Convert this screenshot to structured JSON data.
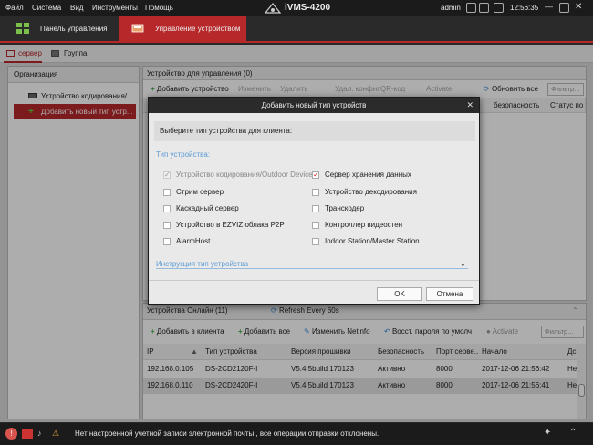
{
  "titlebar": {
    "menu": [
      "Файл",
      "Система",
      "Вид",
      "Инструменты",
      "Помощь"
    ],
    "app_title": "iVMS-4200",
    "user": "admin",
    "clock": "12:56:35"
  },
  "tabs": [
    {
      "label": "Панель управления",
      "icon": "grid-icon"
    },
    {
      "label": "Управление устройством",
      "icon": "device-icon"
    }
  ],
  "subtabs": [
    "сервер",
    "Группа"
  ],
  "organization": {
    "header": "Организация",
    "items": [
      {
        "label": "Устройство кодирования/...",
        "icon": "encoder-icon"
      },
      {
        "label": "Добавить новый тип устр...",
        "icon": "plus-icon"
      }
    ]
  },
  "managed": {
    "header": "Устройство для управления (0)",
    "toolbar": [
      "Добавить устройство",
      "Изменить",
      "Удалить",
      "Удал. конфиг.",
      "QR-код",
      "Activate"
    ],
    "refresh_all": "Обновить все",
    "filter_placeholder": "Фильтр...",
    "columns": [
      "безопасность",
      "Статус по"
    ]
  },
  "online": {
    "tab_label": "Устройства Онлайн (11)",
    "refresh_label": "Refresh Every 60s",
    "toolbar": [
      "Добавить в клиента",
      "Добавить все",
      "Изменить Netinfo",
      "Восст. пароля по умолч",
      "Activate"
    ],
    "filter_placeholder": "Фильтр...",
    "columns": [
      "IP",
      "Тип устройства",
      "Версия прошивки",
      "Безопасность",
      "Порт серве...",
      "Начало",
      "Дс"
    ],
    "rows": [
      [
        "192.168.0.105",
        "DS-2CD2120F-I",
        "V5.4.5build 170123",
        "Активно",
        "8000",
        "2017-12-06 21:56:42",
        "Не"
      ],
      [
        "192.168.0.110",
        "DS-2CD2420F-I",
        "V5.4.5build 170123",
        "Активно",
        "8000",
        "2017-12-06 21:56:41",
        "Не"
      ]
    ]
  },
  "status": {
    "message": "Нет настроенной учетной записи электронной почты , все операции отправки отклонены."
  },
  "dialog": {
    "title": "Добавить новый тип устройств",
    "prompt": "Выберите тип устройства для клиента:",
    "section_label": "Тип устройства:",
    "options_left": [
      {
        "label": "Устройство кодирования/Outdoor Device",
        "checked": true,
        "disabled": true
      },
      {
        "label": "Стрим сервер",
        "checked": false,
        "disabled": false
      },
      {
        "label": "Каскадный сервер",
        "checked": false,
        "disabled": false
      },
      {
        "label": "Устройство в EZVIZ облака P2P",
        "checked": false,
        "disabled": false
      },
      {
        "label": "AlarmHost",
        "checked": false,
        "disabled": false
      }
    ],
    "options_right": [
      {
        "label": "Сервер хранения данных",
        "checked": true,
        "disabled": false
      },
      {
        "label": "Устройство декодирования",
        "checked": false,
        "disabled": false
      },
      {
        "label": "Транскодер",
        "checked": false,
        "disabled": false
      },
      {
        "label": "Контроллер видеостен",
        "checked": false,
        "disabled": false
      },
      {
        "label": "Indoor Station/Master Station",
        "checked": false,
        "disabled": false
      }
    ],
    "instructions_label": "Инструкция тип устройства",
    "ok": "OK",
    "cancel": "Отмена"
  },
  "colors": {
    "accent": "#b7282b",
    "link": "#5b9bd5"
  }
}
